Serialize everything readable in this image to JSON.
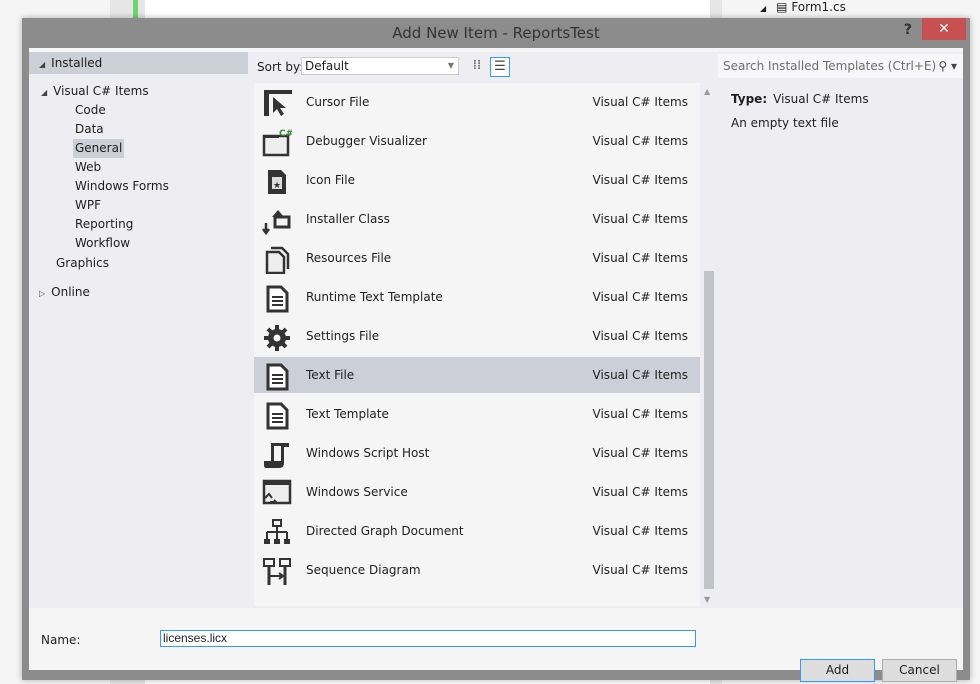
{
  "background": {
    "tree_item": "Form1.cs"
  },
  "dialog": {
    "title": "Add New Item - ReportsTest",
    "help_label": "?",
    "close_label": "✕",
    "tree": {
      "installed": "Installed",
      "visual_cs": "Visual C# Items",
      "children": [
        "Code",
        "Data",
        "General",
        "Web",
        "Windows Forms",
        "WPF",
        "Reporting",
        "Workflow"
      ],
      "selected": "General",
      "graphics": "Graphics",
      "online": "Online"
    },
    "toolbar": {
      "sort_label": "Sort by:",
      "sort_value": "Default"
    },
    "search_placeholder": "Search Installed Templates (Ctrl+E)",
    "items": [
      {
        "name": "Cursor File",
        "type": "Visual C# Items",
        "icon": "cursor"
      },
      {
        "name": "Debugger Visualizer",
        "type": "Visual C# Items",
        "icon": "window-cs"
      },
      {
        "name": "Icon File",
        "type": "Visual C# Items",
        "icon": "icon-file"
      },
      {
        "name": "Installer Class",
        "type": "Visual C# Items",
        "icon": "installer"
      },
      {
        "name": "Resources File",
        "type": "Visual C# Items",
        "icon": "pages"
      },
      {
        "name": "Runtime Text Template",
        "type": "Visual C# Items",
        "icon": "text-doc"
      },
      {
        "name": "Settings File",
        "type": "Visual C# Items",
        "icon": "gear"
      },
      {
        "name": "Text File",
        "type": "Visual C# Items",
        "icon": "text-doc",
        "selected": true
      },
      {
        "name": "Text Template",
        "type": "Visual C# Items",
        "icon": "text-doc"
      },
      {
        "name": "Windows Script Host",
        "type": "Visual C# Items",
        "icon": "scroll"
      },
      {
        "name": "Windows Service",
        "type": "Visual C# Items",
        "icon": "service"
      },
      {
        "name": "Directed Graph Document",
        "type": "Visual C# Items",
        "icon": "graph"
      },
      {
        "name": "Sequence Diagram",
        "type": "Visual C# Items",
        "icon": "sequence"
      }
    ],
    "details": {
      "type_label": "Type:",
      "type_value": "Visual C# Items",
      "description": "An empty text file"
    },
    "name_label": "Name:",
    "name_value": "licenses.licx",
    "add_label": "Add",
    "cancel_label": "Cancel",
    "colors": {
      "selection": "#ccced8",
      "close": "#c75050",
      "focus": "#3399ff",
      "accent_green": "#6fd36f"
    }
  }
}
